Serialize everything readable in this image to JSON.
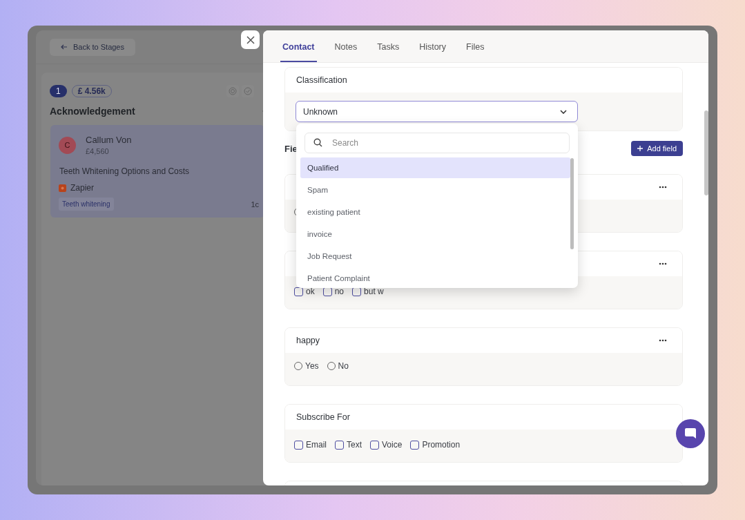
{
  "board": {
    "back_button": "Back to Stages",
    "stage": {
      "count": "1",
      "amount": "£ 4.56k",
      "title": "Acknowledgement"
    },
    "cards": [
      {
        "avatar": "C",
        "name": "Callum Von",
        "value": "£4,560",
        "title": "Teeth Whitening Options and Costs",
        "source": "Zapier",
        "tag": "Teeth whitening",
        "column_5": "1c"
      }
    ]
  },
  "drawer": {
    "tabs": [
      {
        "label": "Contact",
        "selected": true
      },
      {
        "label": "Notes",
        "selected": false
      },
      {
        "label": "Tasks",
        "selected": false
      },
      {
        "label": "History",
        "selected": false
      },
      {
        "label": "Files",
        "selected": false
      }
    ],
    "classification": {
      "label": "Classification",
      "value": "Unknown"
    },
    "dropdown": {
      "search": {
        "placeholder": "Search"
      },
      "options": [
        {
          "label": "Qualified",
          "selected": true
        },
        {
          "label": "Spam",
          "selected": false
        },
        {
          "label": "existing patient",
          "selected": false
        },
        {
          "label": "invoice",
          "selected": false
        },
        {
          "label": "Job Request",
          "selected": false
        },
        {
          "label": "Patient Complaint",
          "selected": false
        }
      ]
    },
    "fields_heading": "Fie",
    "add_button": "Add field",
    "fields": [
      {
        "kind": "radio",
        "menu": true,
        "options": [
          {
            "checked": false
          }
        ]
      },
      {
        "kind": "checkbox",
        "menu": true,
        "options": [
          {
            "label": "ok",
            "checked": false
          },
          {
            "label": "no",
            "checked": false
          },
          {
            "label": "but w",
            "checked": false
          }
        ]
      },
      {
        "kind": "radio",
        "label": "happy",
        "menu": true,
        "options": [
          {
            "label": "Yes",
            "checked": false
          },
          {
            "label": "No",
            "checked": false
          }
        ]
      },
      {
        "kind": "checkbox",
        "label": "Subscribe For",
        "menu": false,
        "options": [
          {
            "label": "Email",
            "checked": false
          },
          {
            "label": "Text",
            "checked": false
          },
          {
            "label": "Voice",
            "checked": false
          },
          {
            "label": "Promotion",
            "checked": false
          }
        ]
      },
      {
        "kind": "empty",
        "menu": false
      }
    ]
  }
}
